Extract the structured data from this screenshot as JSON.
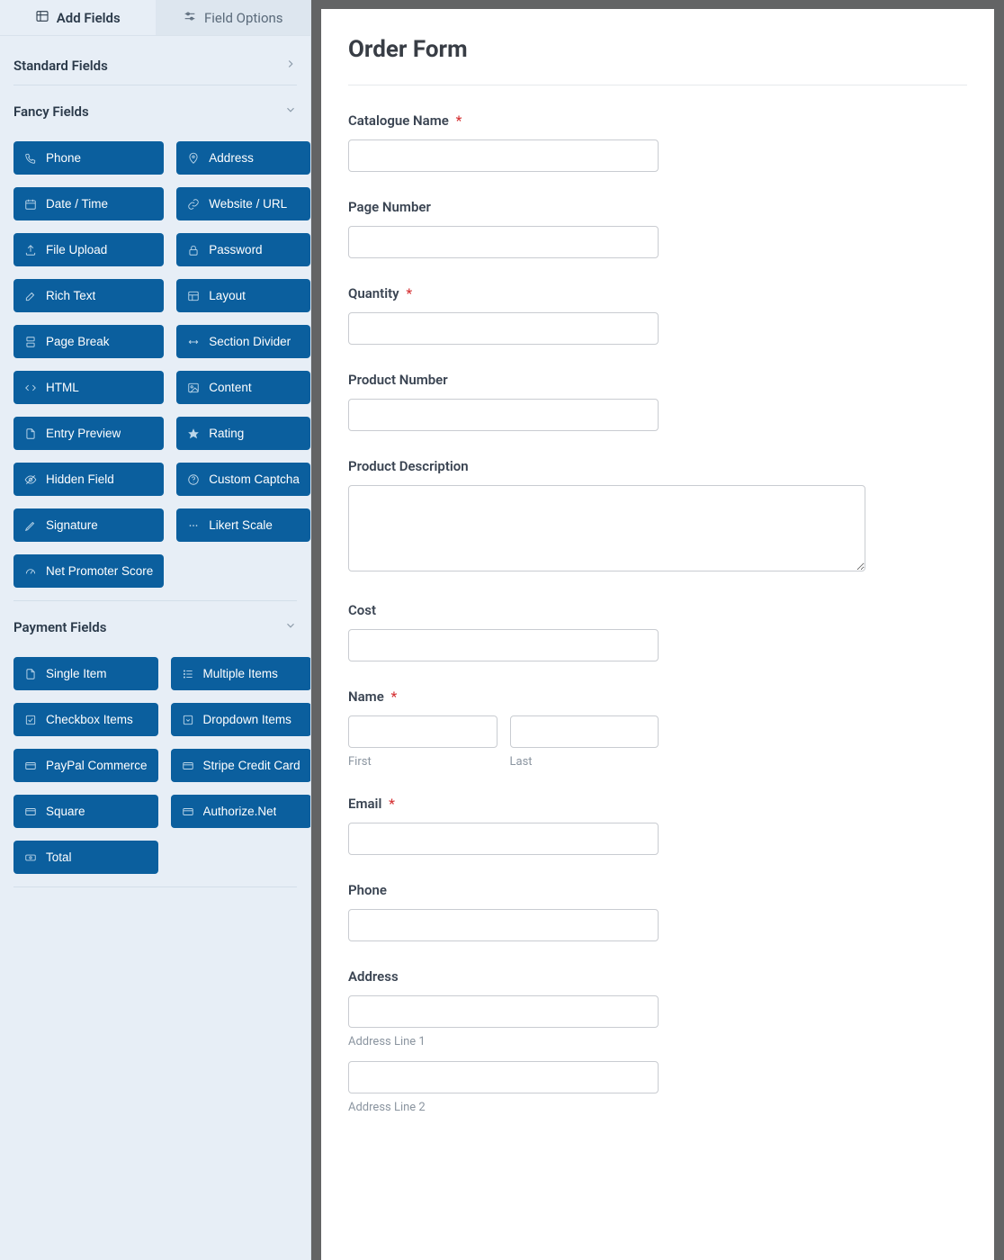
{
  "tabs": {
    "add_fields": "Add Fields",
    "field_options": "Field Options"
  },
  "sections": {
    "standard": {
      "title": "Standard Fields"
    },
    "fancy": {
      "title": "Fancy Fields",
      "items": [
        {
          "icon": "phone-icon",
          "label": "Phone"
        },
        {
          "icon": "pin-icon",
          "label": "Address"
        },
        {
          "icon": "calendar-icon",
          "label": "Date / Time"
        },
        {
          "icon": "link-icon",
          "label": "Website / URL"
        },
        {
          "icon": "upload-icon",
          "label": "File Upload"
        },
        {
          "icon": "lock-icon",
          "label": "Password"
        },
        {
          "icon": "edit-icon",
          "label": "Rich Text"
        },
        {
          "icon": "layout-icon",
          "label": "Layout"
        },
        {
          "icon": "page-break-icon",
          "label": "Page Break"
        },
        {
          "icon": "divider-icon",
          "label": "Section Divider"
        },
        {
          "icon": "code-icon",
          "label": "HTML"
        },
        {
          "icon": "image-icon",
          "label": "Content"
        },
        {
          "icon": "file-icon",
          "label": "Entry Preview"
        },
        {
          "icon": "star-icon",
          "label": "Rating"
        },
        {
          "icon": "eye-off-icon",
          "label": "Hidden Field"
        },
        {
          "icon": "help-icon",
          "label": "Custom Captcha"
        },
        {
          "icon": "pen-icon",
          "label": "Signature"
        },
        {
          "icon": "dots-icon",
          "label": "Likert Scale"
        },
        {
          "icon": "gauge-icon",
          "label": "Net Promoter Score"
        }
      ]
    },
    "payment": {
      "title": "Payment Fields",
      "items": [
        {
          "icon": "file-icon",
          "label": "Single Item"
        },
        {
          "icon": "list-icon",
          "label": "Multiple Items"
        },
        {
          "icon": "check-square-icon",
          "label": "Checkbox Items"
        },
        {
          "icon": "dropdown-icon",
          "label": "Dropdown Items"
        },
        {
          "icon": "card-icon",
          "label": "PayPal Commerce"
        },
        {
          "icon": "card-icon",
          "label": "Stripe Credit Card"
        },
        {
          "icon": "card-icon",
          "label": "Square"
        },
        {
          "icon": "card-icon",
          "label": "Authorize.Net"
        },
        {
          "icon": "money-icon",
          "label": "Total"
        }
      ]
    }
  },
  "form": {
    "title": "Order Form",
    "fields": {
      "catalogue_name": {
        "label": "Catalogue Name",
        "required": true
      },
      "page_number": {
        "label": "Page Number",
        "required": false
      },
      "quantity": {
        "label": "Quantity",
        "required": true
      },
      "product_number": {
        "label": "Product Number",
        "required": false
      },
      "product_description": {
        "label": "Product Description",
        "required": false
      },
      "cost": {
        "label": "Cost",
        "required": false
      },
      "name": {
        "label": "Name",
        "required": true,
        "sub_first": "First",
        "sub_last": "Last"
      },
      "email": {
        "label": "Email",
        "required": true
      },
      "phone": {
        "label": "Phone",
        "required": false
      },
      "address": {
        "label": "Address",
        "required": false,
        "line1": "Address Line 1",
        "line2": "Address Line 2"
      }
    }
  },
  "required_mark": "*"
}
